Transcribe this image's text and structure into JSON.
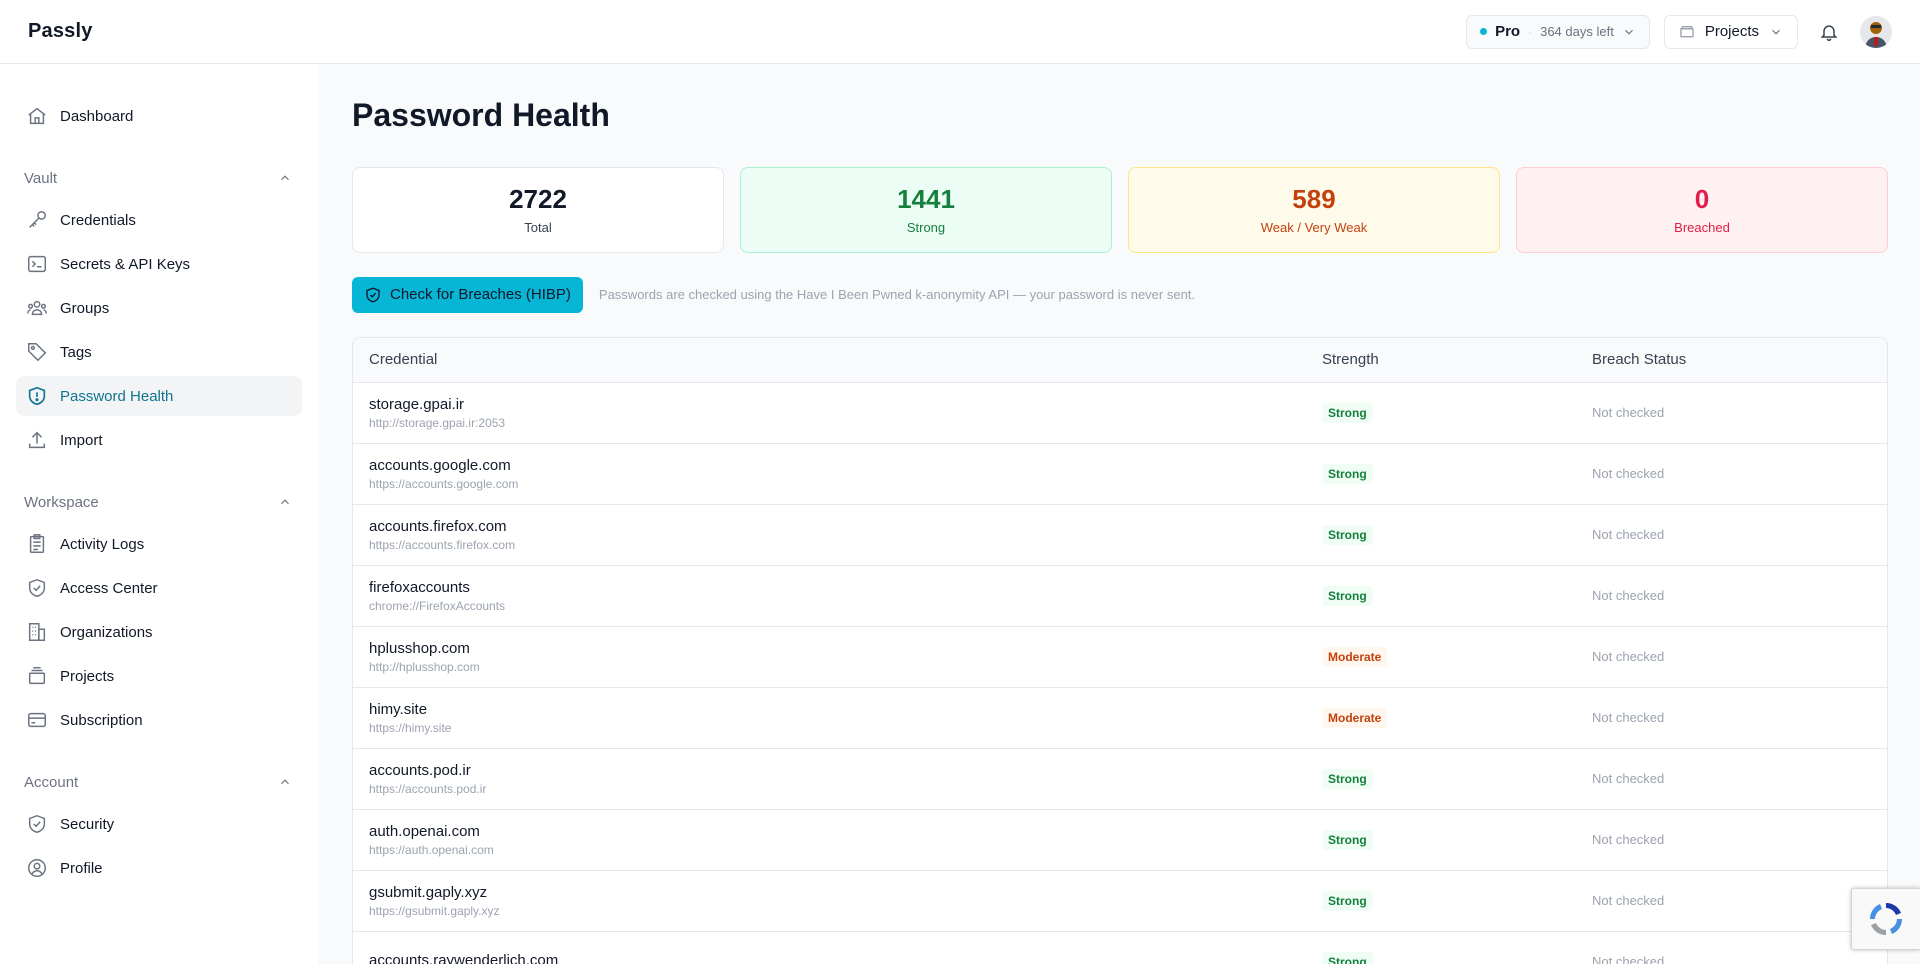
{
  "app": {
    "brand": "Passly"
  },
  "topbar": {
    "plan": {
      "name": "Pro",
      "days_left": "364 days left"
    },
    "projects_label": "Projects"
  },
  "sidebar": {
    "top": [
      {
        "label": "Dashboard",
        "icon": "home-icon"
      }
    ],
    "sections": [
      {
        "title": "Vault",
        "items": [
          {
            "label": "Credentials",
            "icon": "key-icon",
            "active": false
          },
          {
            "label": "Secrets & API Keys",
            "icon": "terminal-icon",
            "active": false
          },
          {
            "label": "Groups",
            "icon": "users-icon",
            "active": false
          },
          {
            "label": "Tags",
            "icon": "tag-icon",
            "active": false
          },
          {
            "label": "Password Health",
            "icon": "shield-alert-icon",
            "active": true
          },
          {
            "label": "Import",
            "icon": "upload-icon",
            "active": false
          }
        ]
      },
      {
        "title": "Workspace",
        "items": [
          {
            "label": "Activity Logs",
            "icon": "clipboard-icon",
            "active": false
          },
          {
            "label": "Access Center",
            "icon": "shield-check-icon",
            "active": false
          },
          {
            "label": "Organizations",
            "icon": "building-icon",
            "active": false
          },
          {
            "label": "Projects",
            "icon": "layers-icon",
            "active": false
          },
          {
            "label": "Subscription",
            "icon": "credit-card-icon",
            "active": false
          }
        ]
      },
      {
        "title": "Account",
        "items": [
          {
            "label": "Security",
            "icon": "shield-check-icon",
            "active": false
          },
          {
            "label": "Profile",
            "icon": "user-circle-icon",
            "active": false
          }
        ]
      }
    ]
  },
  "page": {
    "title": "Password Health",
    "stats": {
      "total": {
        "value": "2722",
        "label": "Total"
      },
      "strong": {
        "value": "1441",
        "label": "Strong"
      },
      "weak": {
        "value": "589",
        "label": "Weak / Very Weak"
      },
      "breached": {
        "value": "0",
        "label": "Breached"
      }
    },
    "hibp_button": "Check for Breaches (HIBP)",
    "hibp_note": "Passwords are checked using the Have I Been Pwned k-anonymity API — your password is never sent."
  },
  "table": {
    "headers": {
      "credential": "Credential",
      "strength": "Strength",
      "breach": "Breach Status"
    },
    "rows": [
      {
        "name": "storage.gpai.ir",
        "url": "http://storage.gpai.ir:2053",
        "strength": "Strong",
        "breach": "Not checked"
      },
      {
        "name": "accounts.google.com",
        "url": "https://accounts.google.com",
        "strength": "Strong",
        "breach": "Not checked"
      },
      {
        "name": "accounts.firefox.com",
        "url": "https://accounts.firefox.com",
        "strength": "Strong",
        "breach": "Not checked"
      },
      {
        "name": "firefoxaccounts",
        "url": "chrome://FirefoxAccounts",
        "strength": "Strong",
        "breach": "Not checked"
      },
      {
        "name": "hplusshop.com",
        "url": "http://hplusshop.com",
        "strength": "Moderate",
        "breach": "Not checked"
      },
      {
        "name": "himy.site",
        "url": "https://himy.site",
        "strength": "Moderate",
        "breach": "Not checked"
      },
      {
        "name": "accounts.pod.ir",
        "url": "https://accounts.pod.ir",
        "strength": "Strong",
        "breach": "Not checked"
      },
      {
        "name": "auth.openai.com",
        "url": "https://auth.openai.com",
        "strength": "Strong",
        "breach": "Not checked"
      },
      {
        "name": "gsubmit.gaply.xyz",
        "url": "https://gsubmit.gaply.xyz",
        "strength": "Strong",
        "breach": "Not checked"
      },
      {
        "name": "accounts.raywenderlich.com",
        "url": "",
        "strength": "Strong",
        "breach": "Not checked"
      }
    ]
  },
  "colors": {
    "accent": "#06b6d4",
    "active_text": "#0e7490",
    "strong": "#15803d",
    "weak": "#c2410c",
    "breached": "#e11d48"
  }
}
